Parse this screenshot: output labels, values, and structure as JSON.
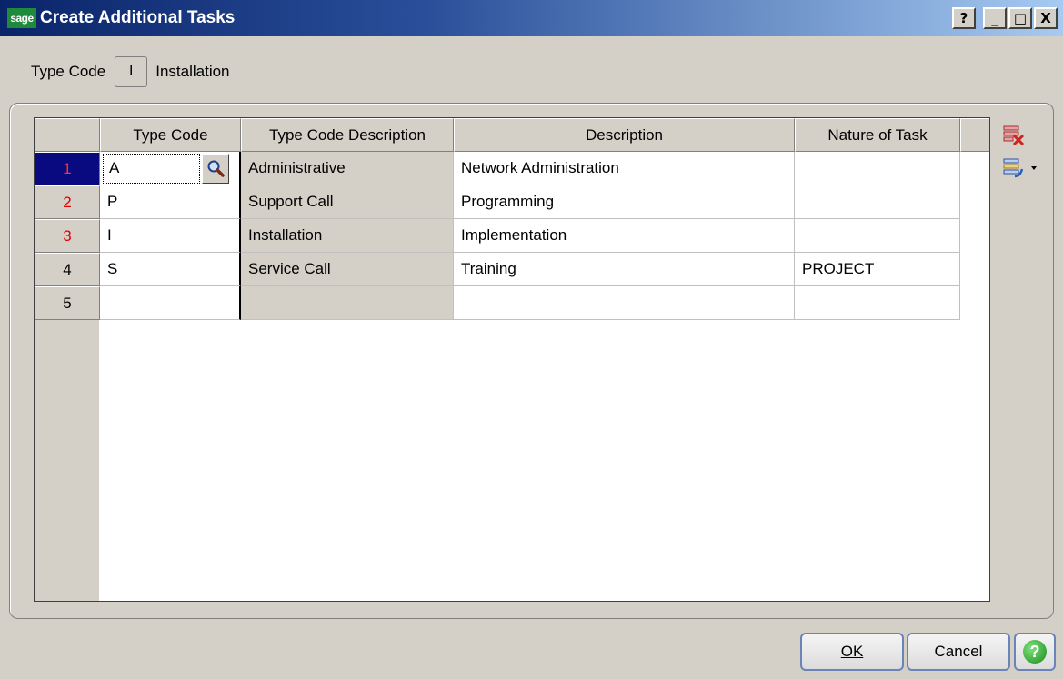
{
  "window": {
    "logo_text": "sage",
    "title": "Create Additional Tasks",
    "help_glyph": "?",
    "minimize_glyph": "_",
    "maximize_glyph": "□",
    "close_glyph": "X"
  },
  "header": {
    "type_code_label": "Type Code",
    "type_code_value": "I",
    "type_code_description": "Installation"
  },
  "grid": {
    "columns": [
      "",
      "Type Code",
      "Type Code Description",
      "Description",
      "Nature of Task"
    ],
    "rows": [
      {
        "num": "1",
        "type_code": "A",
        "type_code_description": "Administrative",
        "description": "Network Administration",
        "nature_of_task": ""
      },
      {
        "num": "2",
        "type_code": "P",
        "type_code_description": "Support Call",
        "description": "Programming",
        "nature_of_task": ""
      },
      {
        "num": "3",
        "type_code": "I",
        "type_code_description": "Installation",
        "description": "Implementation",
        "nature_of_task": ""
      },
      {
        "num": "4",
        "type_code": "S",
        "type_code_description": "Service Call",
        "description": "Training",
        "nature_of_task": "PROJECT"
      },
      {
        "num": "5",
        "type_code": "",
        "type_code_description": "",
        "description": "",
        "nature_of_task": ""
      }
    ],
    "selected_row": 1,
    "row_number_red": [
      "1",
      "2",
      "3"
    ]
  },
  "side_icons": [
    "delete-row-icon",
    "insert-row-dropdown-icon"
  ],
  "buttons": {
    "ok_label": "OK",
    "cancel_label": "Cancel",
    "help_glyph": "?"
  },
  "colors": {
    "title_bar": "#0a246a",
    "selected_row": "#0a0a80",
    "row_number_red": "#e00000",
    "button_border": "#6a84b8",
    "help_green": "#1a8c1a"
  }
}
